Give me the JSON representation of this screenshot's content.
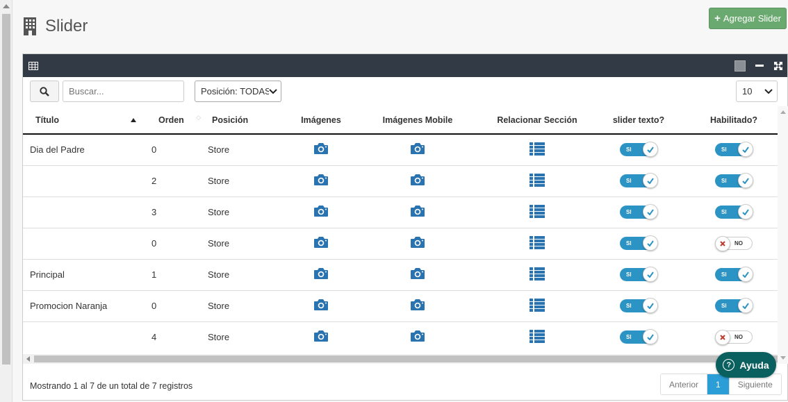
{
  "header": {
    "title": "Slider",
    "icon": "building-icon"
  },
  "actions": {
    "add_label": "Agregar Slider"
  },
  "toolbar": {
    "search_placeholder": "Buscar...",
    "position_filter": "Posición: TODAS",
    "page_length": "10"
  },
  "table": {
    "columns": [
      "Título",
      "Orden",
      "Posición",
      "Imágenes",
      "Imágenes Mobile",
      "Relacionar Sección",
      "slider texto?",
      "Habilitado?"
    ],
    "toggle_on_label": "SI",
    "toggle_off_label": "NO",
    "rows": [
      {
        "titulo": "Dia del Padre",
        "orden": "0",
        "posicion": "Store",
        "slider_texto": true,
        "habilitado": true
      },
      {
        "titulo": "",
        "orden": "2",
        "posicion": "Store",
        "slider_texto": true,
        "habilitado": true
      },
      {
        "titulo": "",
        "orden": "3",
        "posicion": "Store",
        "slider_texto": true,
        "habilitado": true
      },
      {
        "titulo": "",
        "orden": "0",
        "posicion": "Store",
        "slider_texto": true,
        "habilitado": false
      },
      {
        "titulo": "Principal",
        "orden": "1",
        "posicion": "Store",
        "slider_texto": true,
        "habilitado": true
      },
      {
        "titulo": "Promocion Naranja",
        "orden": "0",
        "posicion": "Store",
        "slider_texto": true,
        "habilitado": true
      },
      {
        "titulo": "",
        "orden": "4",
        "posicion": "Store",
        "slider_texto": true,
        "habilitado": false
      }
    ]
  },
  "footer": {
    "info": "Mostrando 1 al 7 de un total de 7 registros",
    "prev": "Anterior",
    "page": "1",
    "next": "Siguiente"
  },
  "help": {
    "label": "Ayuda"
  },
  "colors": {
    "accent": "#2c93c5",
    "icon_blue": "#2a73b1",
    "add_button": "#6aa96f",
    "panel_header": "#313a45",
    "help_bg": "#0a5f5f"
  }
}
